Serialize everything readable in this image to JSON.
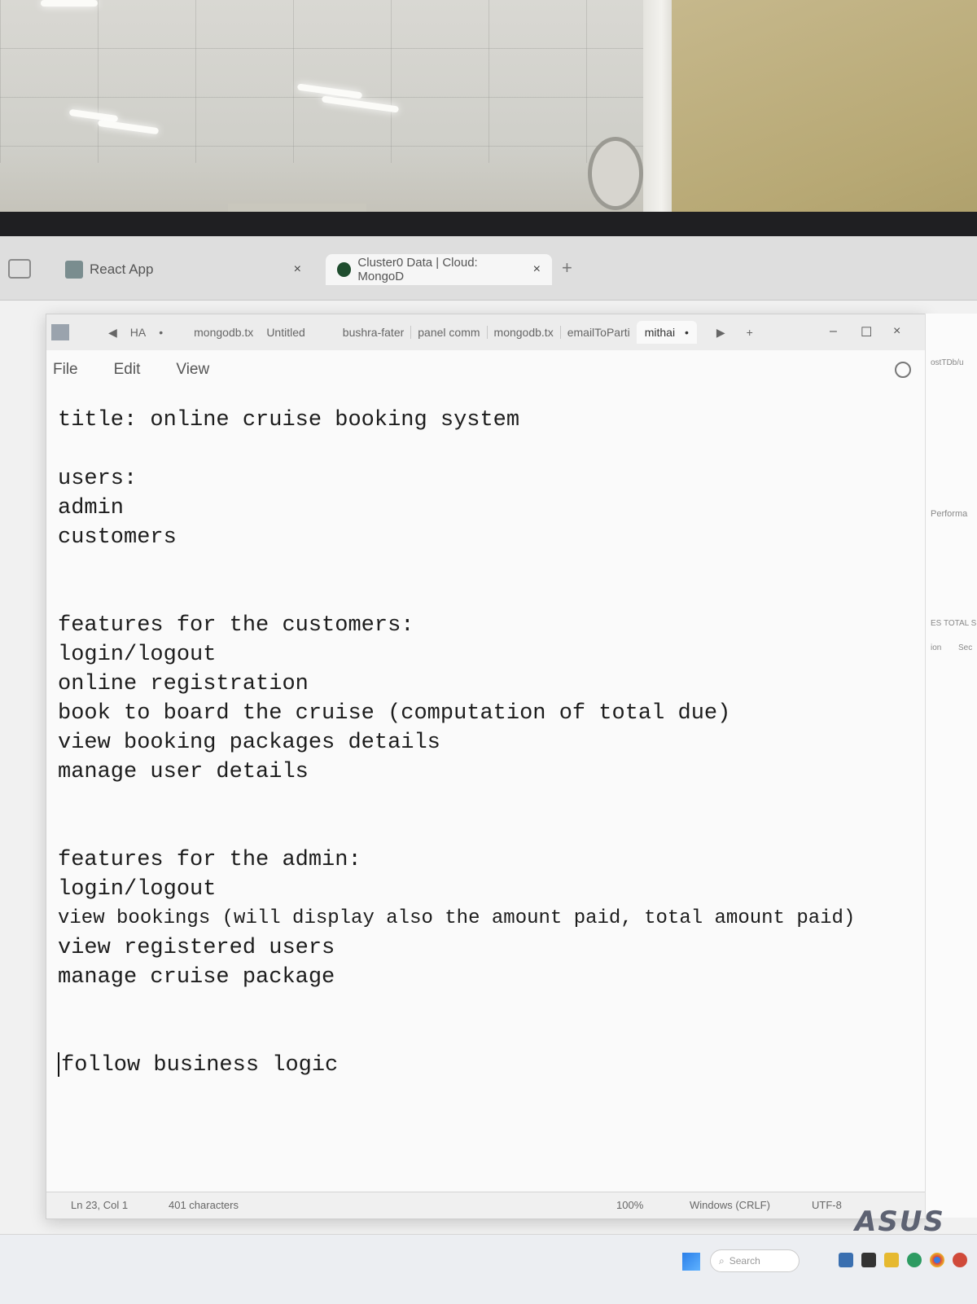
{
  "browser": {
    "tabs": [
      {
        "label": "React App",
        "close": "×"
      },
      {
        "label": "Cluster0 Data | Cloud: MongoD",
        "close": "×"
      }
    ],
    "new_tab": "+"
  },
  "notepad": {
    "tabs": [
      "HA",
      "mongodb.tx",
      "Untitled",
      "bushra-fater",
      "panel comm",
      "mongodb.tx",
      "emailToParti",
      "mithai"
    ],
    "active_tab_dot": "•",
    "new_tab": "+",
    "window_controls": {
      "minimize": "–",
      "maximize": "☐",
      "close": "×"
    },
    "menu": {
      "file": "File",
      "edit": "Edit",
      "view": "View"
    },
    "content": {
      "title": "title: online cruise booking system",
      "users_header": "users:",
      "user_1": "admin",
      "user_2": "customers",
      "customer_header": "features for the customers:",
      "customer_features": [
        "login/logout",
        "online registration",
        "book to board the cruise (computation of total due)",
        "view booking packages details",
        "manage user details"
      ],
      "admin_header": "features for the admin:",
      "admin_features": [
        "login/logout",
        "view bookings (will display also the amount paid, total amount paid)",
        "view registered users",
        "manage cruise package"
      ],
      "footer_line": "follow business logic"
    },
    "status": {
      "position": "Ln 23, Col 1",
      "characters": "401 characters",
      "zoom": "100%",
      "line_ending": "Windows (CRLF)",
      "encoding": "UTF-8"
    }
  },
  "background_window": {
    "crumb": "ostTDb/u",
    "tab_label": "Performa",
    "size_label": "ES TOTAL SIZE:",
    "col_1": "ion",
    "col_2": "Sec"
  },
  "taskbar": {
    "search_placeholder": "Search"
  },
  "hardware": {
    "brand": "ASUS"
  }
}
